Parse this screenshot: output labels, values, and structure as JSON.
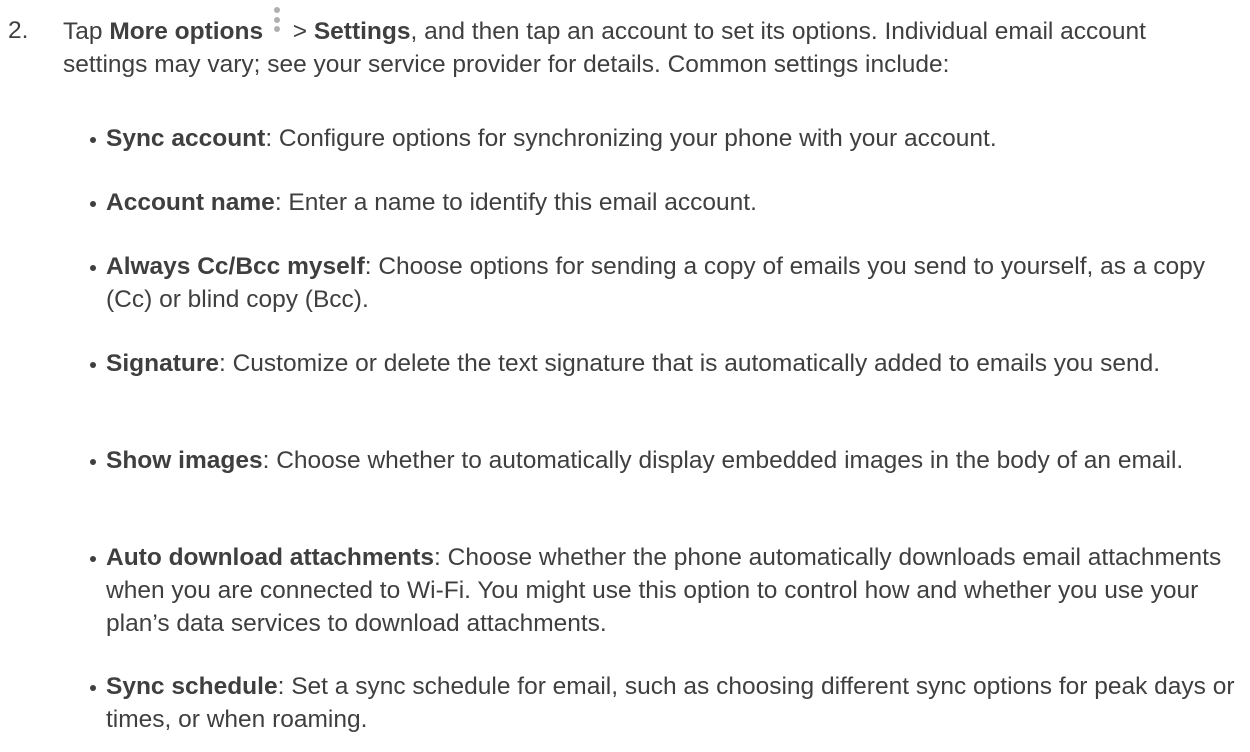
{
  "step": {
    "number": "2.",
    "part1": "Tap ",
    "more_options": "More options",
    "part2": " > ",
    "settings": "Settings",
    "part3": ", and then tap an account to set its options. Individual email account settings may vary; see your service provider for details. Common settings include:"
  },
  "settings_list": [
    {
      "term": "Sync account",
      "desc": ": Configure options for synchronizing your phone with your account."
    },
    {
      "term": "Account name",
      "desc": ": Enter a name to identify this email account."
    },
    {
      "term": "Always Cc/Bcc myself",
      "desc": ": Choose options for sending a copy of emails you send to yourself, as a copy (Cc) or blind copy (Bcc)."
    },
    {
      "term": "Signature",
      "desc": ": Customize or delete the text signature that is automatically added to emails you send."
    },
    {
      "term": "Show images",
      "desc": ": Choose whether to automatically display embedded images in the body of an email."
    },
    {
      "term": "Auto download attachments",
      "desc": ": Choose whether the phone automatically downloads email attachments when you are connected to Wi-Fi. You might use this option to control how and whether you use your plan’s data services to download attachments."
    },
    {
      "term": "Sync schedule",
      "desc": ": Set a sync schedule for email, such as choosing different sync options for peak days or times, or when roaming."
    }
  ],
  "icons": {
    "more_options": "vertical-ellipsis-icon"
  }
}
